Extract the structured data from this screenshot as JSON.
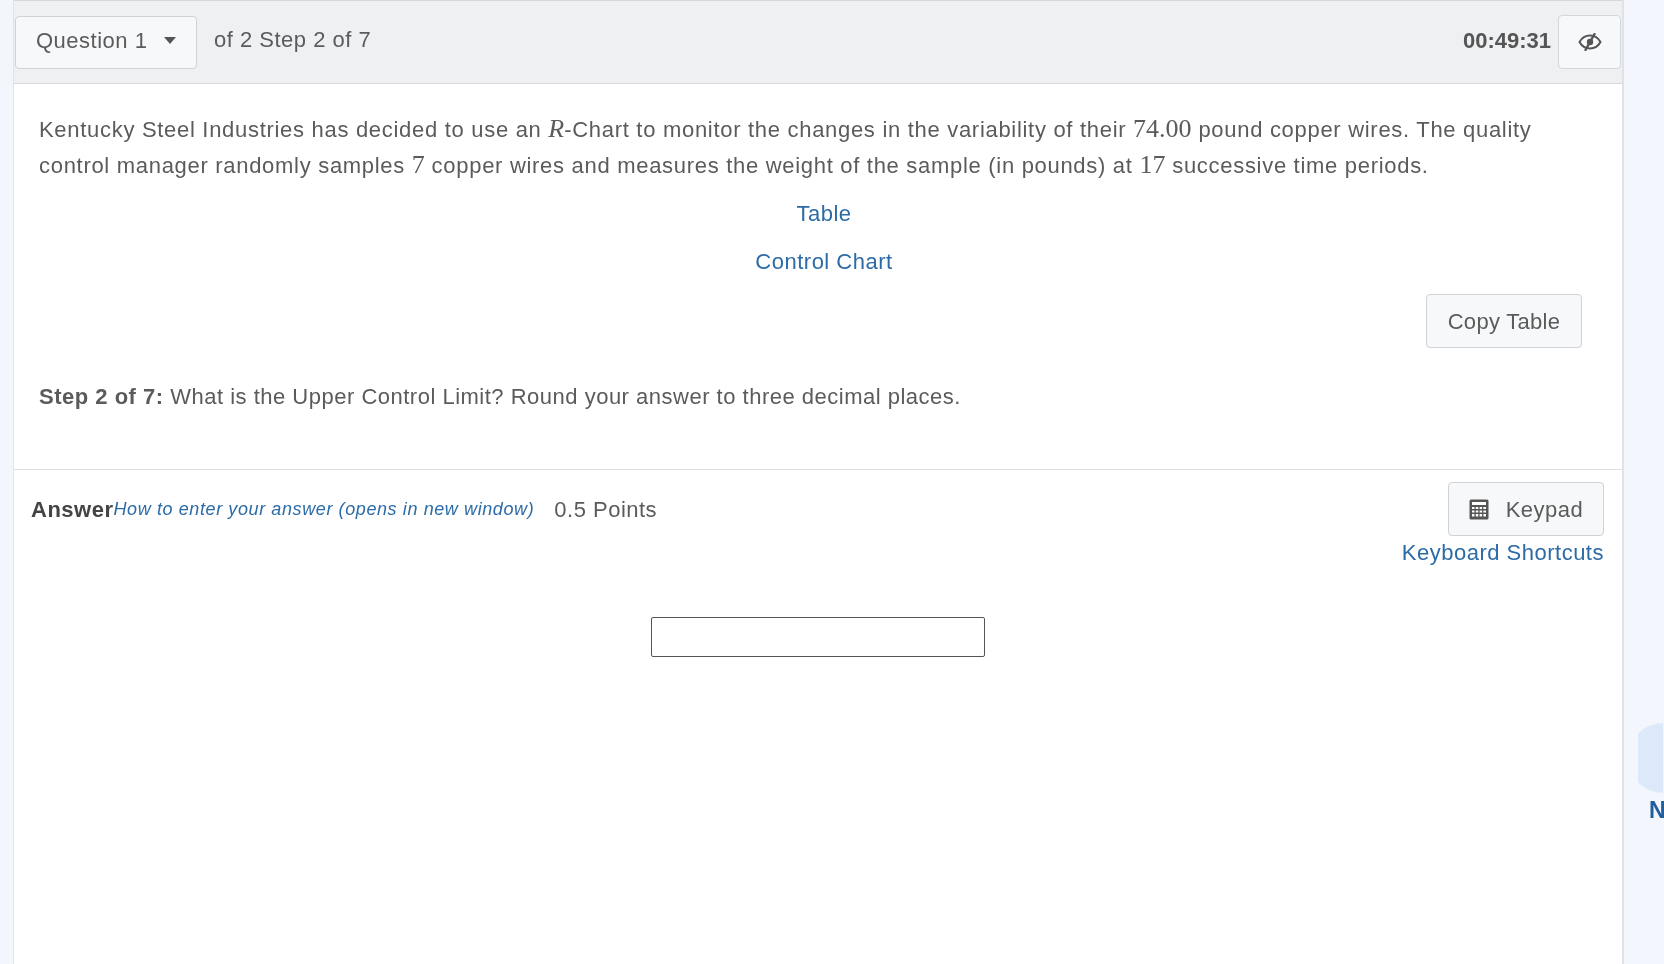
{
  "header": {
    "question_select": "Question 1",
    "progress": "of 2 Step 2 of 7",
    "timer": "00:49:31"
  },
  "problem": {
    "parts": [
      {
        "kind": "text",
        "text": "Kentucky Steel Industries has decided to use an "
      },
      {
        "kind": "var",
        "text": "R"
      },
      {
        "kind": "text",
        "text": "-Chart to monitor the changes in the variability of their "
      },
      {
        "kind": "num",
        "text": "74.00"
      },
      {
        "kind": "text",
        "text": " pound copper wires. The quality control manager randomly samples "
      },
      {
        "kind": "num",
        "text": "7"
      },
      {
        "kind": "text",
        "text": " copper wires and measures the weight of the sample (in pounds) at "
      },
      {
        "kind": "num",
        "text": "17"
      },
      {
        "kind": "text",
        "text": " successive time periods."
      }
    ],
    "links": [
      "Table",
      "Control Chart"
    ],
    "copy_button": "Copy Table",
    "step_prompt": "**Step 2 of 7:** What is the Upper Control Limit? Round your answer to three decimal places."
  },
  "answer": {
    "label": "Answer",
    "help_link": "How to enter your answer (opens in new window)",
    "points": "0.5 Points",
    "keypad_button": "Keypad",
    "shortcuts_link": "Keyboard Shortcuts"
  },
  "side": {
    "label": "N"
  }
}
